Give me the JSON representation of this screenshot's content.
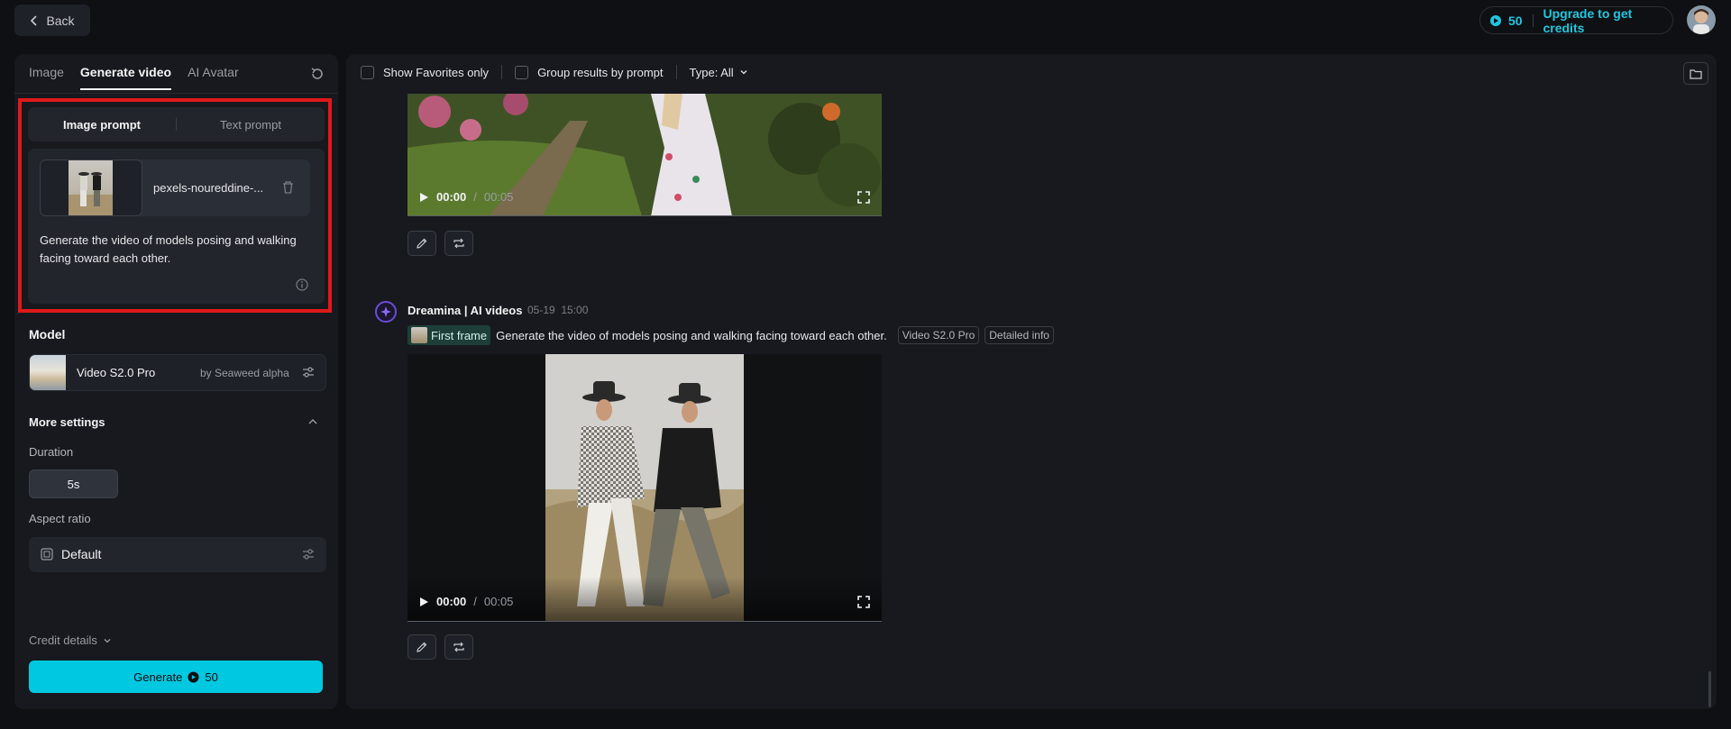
{
  "topbar": {
    "back_label": "Back",
    "credits": "50",
    "upgrade_label": "Upgrade to get credits"
  },
  "left": {
    "tabs": [
      {
        "label": "Image"
      },
      {
        "label": "Generate video"
      },
      {
        "label": "AI Avatar"
      }
    ],
    "prompt_tabs": [
      {
        "label": "Image prompt"
      },
      {
        "label": "Text prompt"
      }
    ],
    "file_name": "pexels-noureddine-...",
    "prompt_text": "Generate the video of models posing and walking facing toward each other.",
    "model_label": "Model",
    "model_name": "Video S2.0 Pro",
    "model_by": "by Seaweed alpha",
    "more_settings_label": "More settings",
    "duration_label": "Duration",
    "duration_value": "5s",
    "aspect_label": "Aspect ratio",
    "aspect_value": "Default",
    "credit_details_label": "Credit details",
    "generate_label": "Generate",
    "generate_cost": "50"
  },
  "main": {
    "filters": {
      "favorites_label": "Show Favorites only",
      "group_label": "Group results by prompt",
      "type_label": "Type: All"
    },
    "video1": {
      "time": "00:00",
      "sep": "/",
      "duration": "00:05"
    },
    "result": {
      "brand": "Dreamina | AI videos",
      "date": "05-19",
      "time": "15:00",
      "first_frame_label": "First frame",
      "prompt": "Generate the video of models posing and walking facing toward each other.",
      "tags": [
        "Video S2.0 Pro",
        "Detailed info"
      ]
    },
    "video2": {
      "time": "00:00",
      "sep": "/",
      "duration": "00:05"
    }
  },
  "colors": {
    "accent": "#00c8e0",
    "highlight": "#e0191a",
    "brand": "#6b4cd6"
  }
}
